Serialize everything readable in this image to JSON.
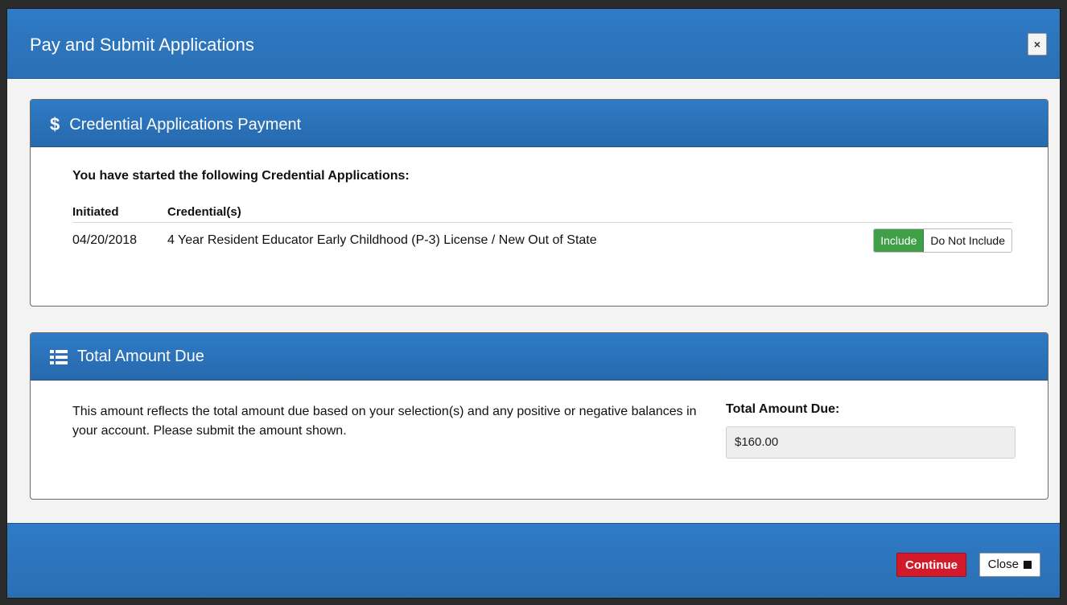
{
  "modal": {
    "title": "Pay and Submit Applications",
    "close_symbol": "×"
  },
  "credentials_panel": {
    "icon": "dollar-icon",
    "icon_glyph": "$",
    "title": "Credential Applications Payment",
    "intro": "You have started the following Credential Applications:",
    "columns": [
      "Initiated",
      "Credential(s)"
    ],
    "rows": [
      {
        "initiated": "04/20/2018",
        "credential": "4 Year Resident Educator Early Childhood (P-3) License / New Out of State",
        "toggle": {
          "include_label": "Include",
          "exclude_label": "Do Not Include",
          "selected": "Include"
        }
      }
    ]
  },
  "total_panel": {
    "icon": "list-icon",
    "title": "Total Amount Due",
    "description": "This amount reflects the total amount due based on your selection(s) and any positive or negative balances in your account. Please submit the amount shown.",
    "label": "Total Amount Due:",
    "amount": "$160.00"
  },
  "footer": {
    "continue_label": "Continue",
    "close_label": "Close",
    "close_icon": "stop-square-icon"
  },
  "colors": {
    "header_blue": "#2f7bc6",
    "include_green": "#3fa048",
    "continue_red": "#d21a2a"
  }
}
